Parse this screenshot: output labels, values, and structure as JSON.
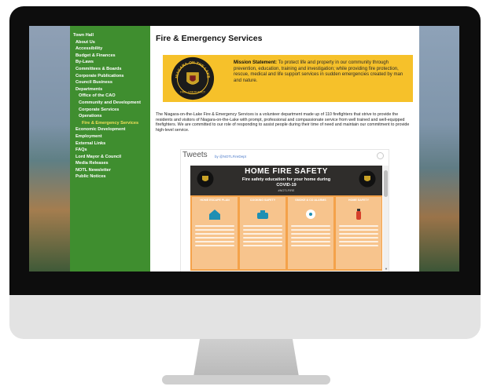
{
  "page": {
    "title": "Fire & Emergency Services",
    "mission_label": "Mission Statement:",
    "mission_text": "To protect life and property in our community through prevention, education, training and investigation; while providing fire protection, rescue, medical and life support services in sudden emergencies created by man and nature.",
    "intro_text": "The Niagara-on-the-Lake Fire & Emergency Services is a volunteer department made up of 110 firefighters that strive to provide the residents and visitors of Niagara-on-the-Lake with prompt, professional and compassionate service from well trained and well-equipped firefighters. We are committed to our role of responding to assist people during their time of need and maintain our commitment to provide high-level service."
  },
  "seal": {
    "top_text": "NIAGARA-ON-THE-LAKE",
    "bottom_text": "FIRE · EMERGENCY"
  },
  "sidebar": {
    "items": [
      {
        "label": "Town Hall",
        "level": 0
      },
      {
        "label": "About Us",
        "level": 1
      },
      {
        "label": "Accessibility",
        "level": 1
      },
      {
        "label": "Budget & Finances",
        "level": 1
      },
      {
        "label": "By-Laws",
        "level": 1
      },
      {
        "label": "Committees & Boards",
        "level": 1
      },
      {
        "label": "Corporate Publications",
        "level": 1
      },
      {
        "label": "Council Business",
        "level": 1
      },
      {
        "label": "Departments",
        "level": 1
      },
      {
        "label": "Office of the CAO",
        "level": 2
      },
      {
        "label": "Community and Development",
        "level": 2
      },
      {
        "label": "Corporate Services",
        "level": 2
      },
      {
        "label": "Operations",
        "level": 2
      },
      {
        "label": "Fire & Emergency Services",
        "level": 3,
        "active": true
      },
      {
        "label": "Economic Development",
        "level": 1
      },
      {
        "label": "Employment",
        "level": 1
      },
      {
        "label": "External Links",
        "level": 1
      },
      {
        "label": "FAQs",
        "level": 1
      },
      {
        "label": "Lord Mayor & Council",
        "level": 1
      },
      {
        "label": "Media Releases",
        "level": 1
      },
      {
        "label": "NOTL Newsletter",
        "level": 1
      },
      {
        "label": "Public Notices",
        "level": 1
      }
    ]
  },
  "tweets": {
    "title": "Tweets",
    "handle": "by @NOTLFireDept"
  },
  "poster": {
    "title": "HOME FIRE SAFETY",
    "subtitle_1": "Fire safety education for your home during",
    "subtitle_2": "COVID-19",
    "tag": "#NOTLFIRE",
    "columns": [
      "HOME ESCAPE PLAN",
      "COOKING SAFETY",
      "SMOKE & CO ALARMS",
      "HOME SAFETY"
    ]
  },
  "colors": {
    "sidebar_green": "#3f8e2f",
    "active_yellow": "#f1e05a",
    "mission_yellow": "#f6c12a",
    "poster_orange": "#f4a24a"
  }
}
